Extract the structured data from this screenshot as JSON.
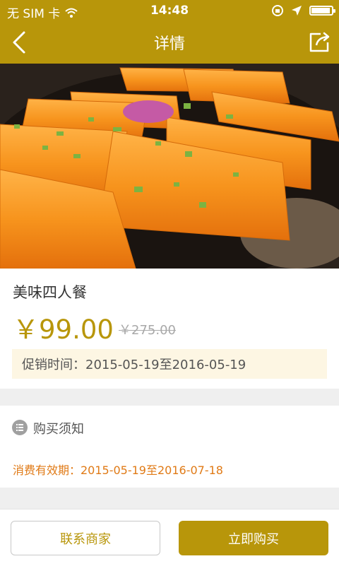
{
  "status_bar": {
    "carrier": "无 SIM 卡",
    "time": "14:48",
    "icons": [
      "wifi-icon",
      "rotation-lock-icon",
      "location-arrow-icon",
      "battery-icon"
    ]
  },
  "navbar": {
    "title": "详情",
    "back_icon": "chevron-left-icon",
    "share_icon": "share-icon"
  },
  "product": {
    "image_alt": "food-photo",
    "name": "美味四人餐",
    "price": "￥99.00",
    "original_price": "￥275.00",
    "promotion_time": "促销时间：2015-05-19至2016-05-19"
  },
  "purchase_notice": {
    "label": "购买须知",
    "icon": "list-icon",
    "validity": "消费有效期：2015-05-19至2016-07-18"
  },
  "actions": {
    "contact_label": "联系商家",
    "buy_label": "立即购买"
  },
  "colors": {
    "brand": "#b8960a",
    "price": "#b8960a",
    "validity": "#e07a16",
    "promo_bg": "#fdf6e3"
  }
}
